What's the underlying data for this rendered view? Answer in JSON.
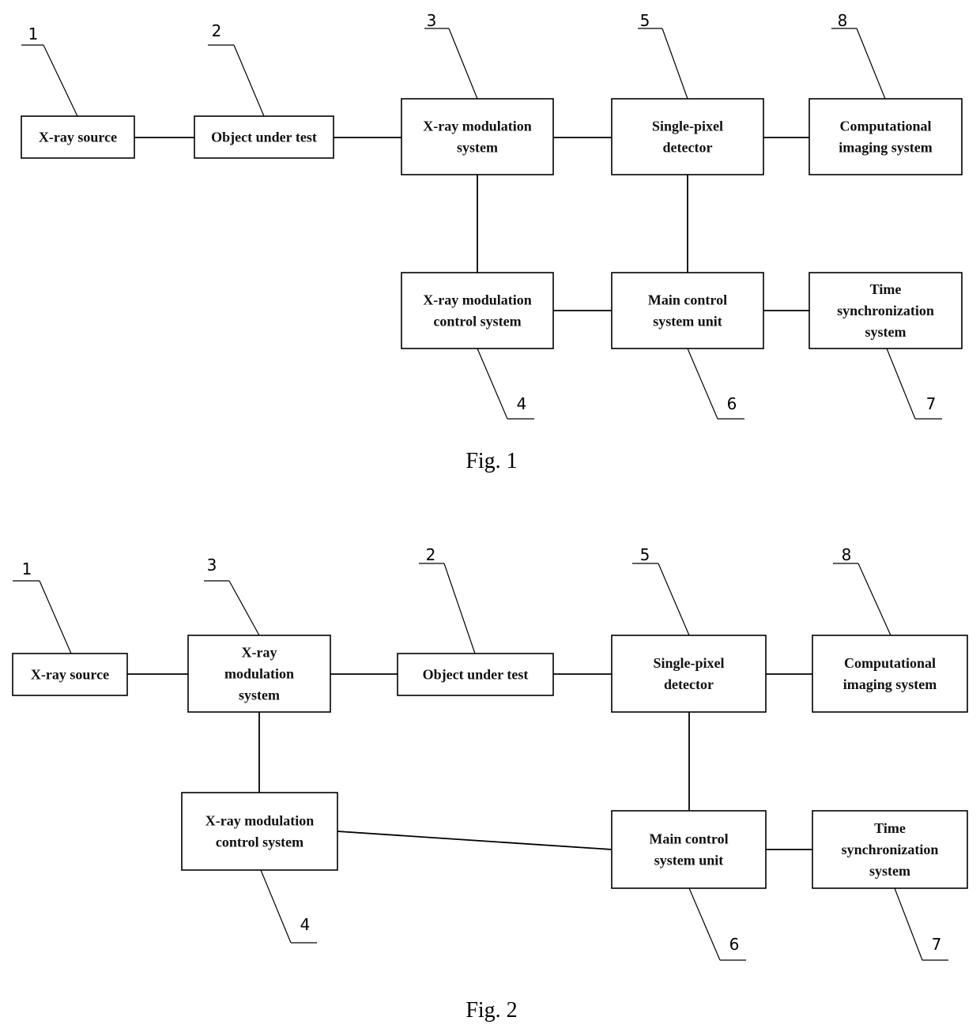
{
  "figures": [
    {
      "id": "fig1",
      "caption": "Fig. 1",
      "blocks": [
        {
          "key": "xray_source",
          "number": "1",
          "lines": [
            "X-ray source"
          ]
        },
        {
          "key": "object",
          "number": "2",
          "lines": [
            "Object under test"
          ]
        },
        {
          "key": "modulation",
          "number": "3",
          "lines": [
            "X-ray modulation",
            "system"
          ]
        },
        {
          "key": "detector",
          "number": "5",
          "lines": [
            "Single-pixel",
            "detector"
          ]
        },
        {
          "key": "imaging",
          "number": "8",
          "lines": [
            "Computational",
            "imaging system"
          ]
        },
        {
          "key": "mod_control",
          "number": "4",
          "lines": [
            "X-ray modulation",
            "control system"
          ]
        },
        {
          "key": "main_control",
          "number": "6",
          "lines": [
            "Main control",
            "system unit"
          ]
        },
        {
          "key": "time_sync",
          "number": "7",
          "lines": [
            "Time",
            "synchronization",
            "system"
          ]
        }
      ],
      "connections": [
        [
          "xray_source",
          "object"
        ],
        [
          "object",
          "modulation"
        ],
        [
          "modulation",
          "detector"
        ],
        [
          "detector",
          "imaging"
        ],
        [
          "modulation",
          "mod_control"
        ],
        [
          "detector",
          "main_control"
        ],
        [
          "mod_control",
          "main_control"
        ],
        [
          "main_control",
          "time_sync"
        ]
      ]
    },
    {
      "id": "fig2",
      "caption": "Fig. 2",
      "blocks": [
        {
          "key": "xray_source",
          "number": "1",
          "lines": [
            "X-ray source"
          ]
        },
        {
          "key": "modulation",
          "number": "3",
          "lines": [
            "X-ray",
            "modulation",
            "system"
          ]
        },
        {
          "key": "object",
          "number": "2",
          "lines": [
            "Object under test"
          ]
        },
        {
          "key": "detector",
          "number": "5",
          "lines": [
            "Single-pixel",
            "detector"
          ]
        },
        {
          "key": "imaging",
          "number": "8",
          "lines": [
            "Computational",
            "imaging system"
          ]
        },
        {
          "key": "mod_control",
          "number": "4",
          "lines": [
            "X-ray modulation",
            "control system"
          ]
        },
        {
          "key": "main_control",
          "number": "6",
          "lines": [
            "Main control",
            "system unit"
          ]
        },
        {
          "key": "time_sync",
          "number": "7",
          "lines": [
            "Time",
            "synchronization",
            "system"
          ]
        }
      ],
      "connections": [
        [
          "xray_source",
          "modulation"
        ],
        [
          "modulation",
          "object"
        ],
        [
          "object",
          "detector"
        ],
        [
          "detector",
          "imaging"
        ],
        [
          "modulation",
          "mod_control"
        ],
        [
          "detector",
          "main_control"
        ],
        [
          "mod_control",
          "main_control"
        ],
        [
          "main_control",
          "time_sync"
        ]
      ]
    }
  ]
}
